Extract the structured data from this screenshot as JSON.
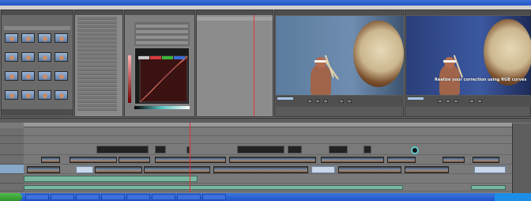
{
  "overlay": {
    "caption": "Realize your correction using RGB curves"
  },
  "curves": {
    "chip_colors": [
      "#c8c8c8",
      "#d43c3c",
      "#3cb43c",
      "#3c6cd4"
    ]
  },
  "colors": {
    "playhead": "#d33333",
    "audio_clip": "#7bb7a0",
    "taskbar": "#2456c4",
    "start_button": "#3fa83c"
  },
  "icons": {
    "start": "windows-start-icon",
    "play": "play-icon",
    "stop": "stop-icon"
  }
}
